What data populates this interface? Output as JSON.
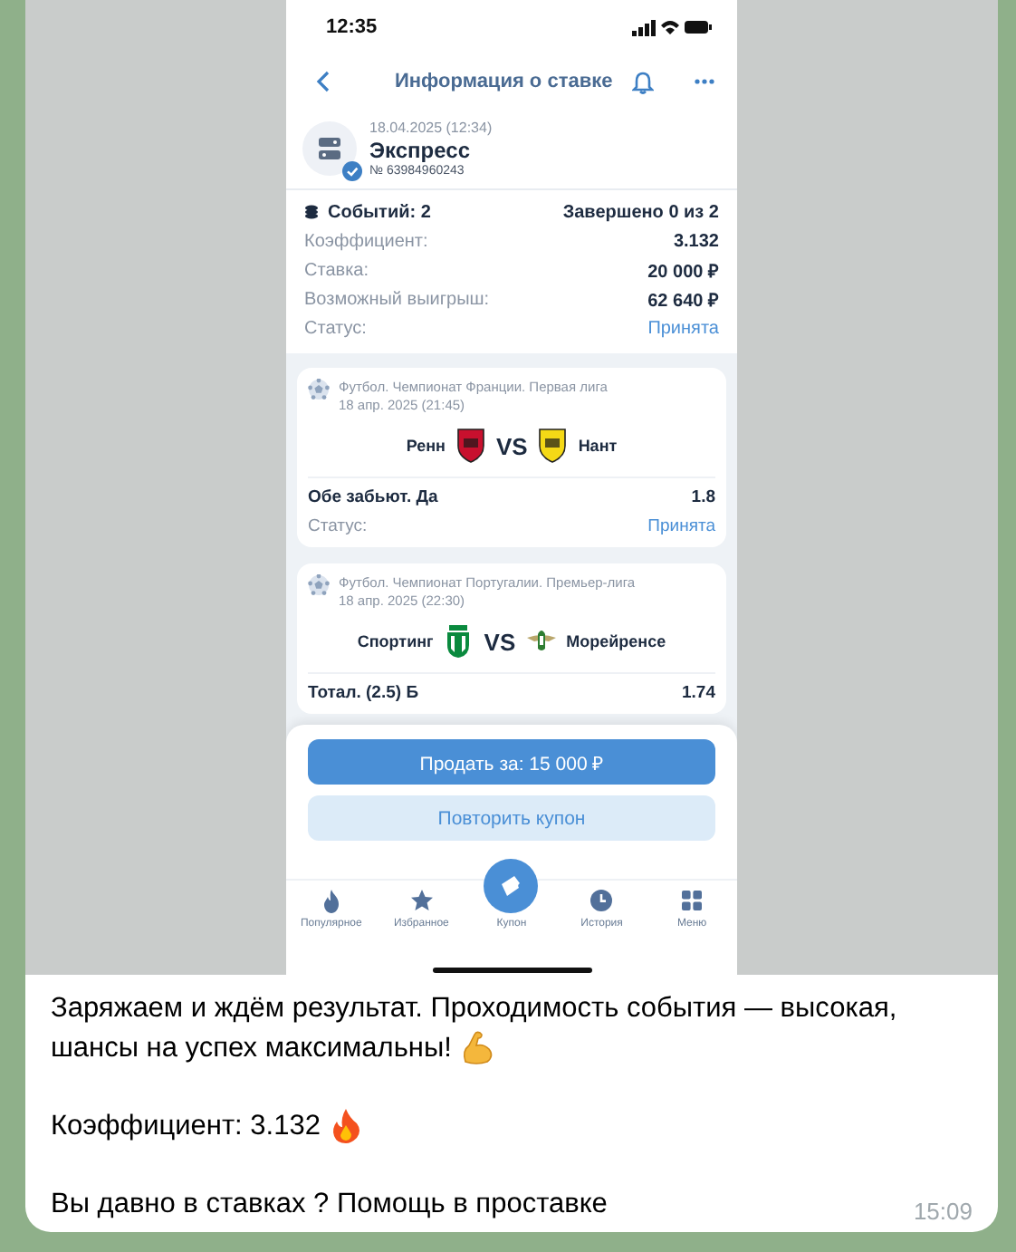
{
  "photo": {
    "status_bar": {
      "time": "12:35"
    },
    "header": {
      "title": "Информация о ставке"
    },
    "bet": {
      "date": "18.04.2025 (12:34)",
      "type": "Экспресс",
      "number": "№ 63984960243",
      "verified": true
    },
    "summary": {
      "events": "Событий: 2",
      "completed": "Завершено 0 из 2",
      "rows": [
        {
          "label": "Коэффициент:",
          "value": "3.132",
          "kind": "plain"
        },
        {
          "label": "Ставка:",
          "value": "20 000 ₽",
          "kind": "plain"
        },
        {
          "label": "Возможный выигрыш:",
          "value": "62 640 ₽",
          "kind": "plain"
        },
        {
          "label": "Статус:",
          "value": "Принята",
          "kind": "status"
        }
      ]
    },
    "events": [
      {
        "league": "Футбол. Чемпионат Франции. Первая лига",
        "date": "18 апр. 2025 (21:45)",
        "home": {
          "name": "Ренн",
          "kind": "shield",
          "color": "#c8102e"
        },
        "vs": "VS",
        "away": {
          "name": "Нант",
          "kind": "shield",
          "color": "#f5d916"
        },
        "market": "Обе забьют. Да",
        "odds": "1.8",
        "status_label": "Статус:",
        "status": "Принята"
      },
      {
        "league": "Футбол. Чемпионат Португалии. Премьер-лига",
        "date": "18 апр. 2025 (22:30)",
        "home": {
          "name": "Спортинг",
          "kind": "round",
          "color": "#0a8a3e"
        },
        "vs": "VS",
        "away": {
          "name": "Морейренсе",
          "kind": "wings",
          "color": "#2e7d32"
        },
        "market": "Тотал. (2.5) Б",
        "odds": "1.74"
      }
    ],
    "actions": [
      {
        "label": "Продать за: 15 000 ₽",
        "kind": "primary"
      },
      {
        "label": "Повторить купон",
        "kind": "secondary"
      }
    ],
    "nav": [
      {
        "label": "Популярное",
        "kind": "fire",
        "selected": false
      },
      {
        "label": "Избранное",
        "kind": "star",
        "selected": false
      },
      {
        "label": "Купон",
        "kind": "ticket",
        "selected": true
      },
      {
        "label": "История",
        "kind": "clock",
        "selected": false
      },
      {
        "label": "Меню",
        "kind": "grid",
        "selected": false
      }
    ]
  },
  "message": {
    "paragraphs": [
      {
        "lines": [
          "Заряжаем и ждём результат. Проходимость события — высокая,",
          "шансы на успех максимальны!"
        ],
        "kind": "muscle"
      },
      {
        "lines": [
          "Коэффициент: 3.132"
        ],
        "kind": "fire"
      },
      {
        "lines": [
          "Вы давно в ставках ? Помощь в проставке"
        ],
        "kind": "plain"
      }
    ],
    "time": "15:09"
  }
}
